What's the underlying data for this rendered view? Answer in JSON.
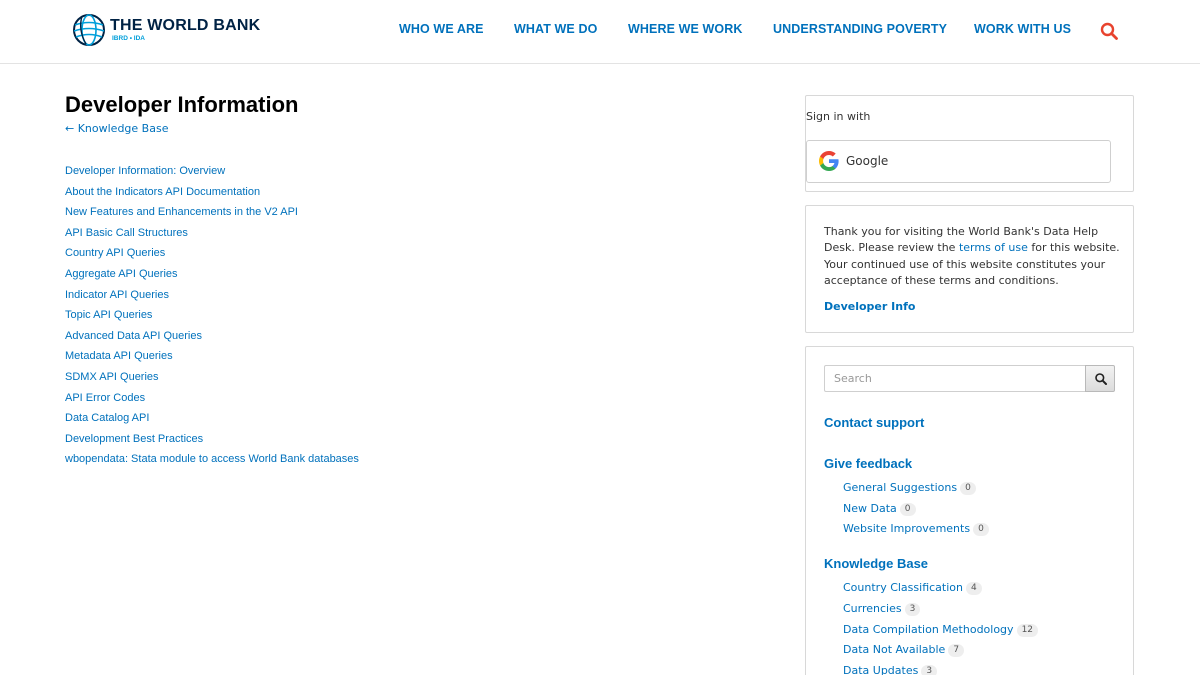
{
  "header": {
    "logo_title": "THE WORLD BANK",
    "logo_subtitle": "IBRD • IDA",
    "nav": [
      "WHO WE ARE",
      "WHAT WE DO",
      "WHERE WE WORK",
      "UNDERSTANDING POVERTY",
      "WORK WITH US"
    ],
    "search_icon": "search-icon"
  },
  "main": {
    "title": "Developer Information",
    "back_link": "← Knowledge Base",
    "articles": [
      "Developer Information: Overview",
      "About the Indicators API Documentation",
      "New Features and Enhancements in the V2 API",
      "API Basic Call Structures",
      "Country API Queries",
      "Aggregate API Queries",
      "Indicator API Queries",
      "Topic API Queries",
      "Advanced Data API Queries",
      "Metadata API Queries",
      "SDMX API Queries",
      "API Error Codes",
      "Data Catalog API",
      "Development Best Practices",
      "wbopendata: Stata module to access World Bank databases"
    ]
  },
  "sidebar": {
    "signin": {
      "label": "Sign in with",
      "google_label": "Google"
    },
    "info": {
      "text_before": "Thank you for visiting the World Bank's Data Help Desk. Please review the ",
      "terms_link": "terms of use",
      "text_after": " for this website. Your continued use of this website constitutes your acceptance of these terms and conditions.",
      "developer_link": "Developer Info"
    },
    "search": {
      "placeholder": "Search"
    },
    "contact_support": "Contact support",
    "give_feedback": {
      "heading": "Give feedback",
      "items": [
        {
          "label": "General Suggestions",
          "count": "0"
        },
        {
          "label": "New Data",
          "count": "0"
        },
        {
          "label": "Website Improvements",
          "count": "0"
        }
      ]
    },
    "knowledge_base": {
      "heading": "Knowledge Base",
      "items": [
        {
          "label": "Country Classification",
          "count": "4"
        },
        {
          "label": "Currencies",
          "count": "3"
        },
        {
          "label": "Data Compilation Methodology",
          "count": "12"
        },
        {
          "label": "Data Not Available",
          "count": "7"
        },
        {
          "label": "Data Updates",
          "count": "3"
        }
      ]
    }
  },
  "colors": {
    "link": "#0071bc",
    "brand_dark": "#002244",
    "brand_light": "#009fda",
    "search_icon": "#e8432e"
  }
}
